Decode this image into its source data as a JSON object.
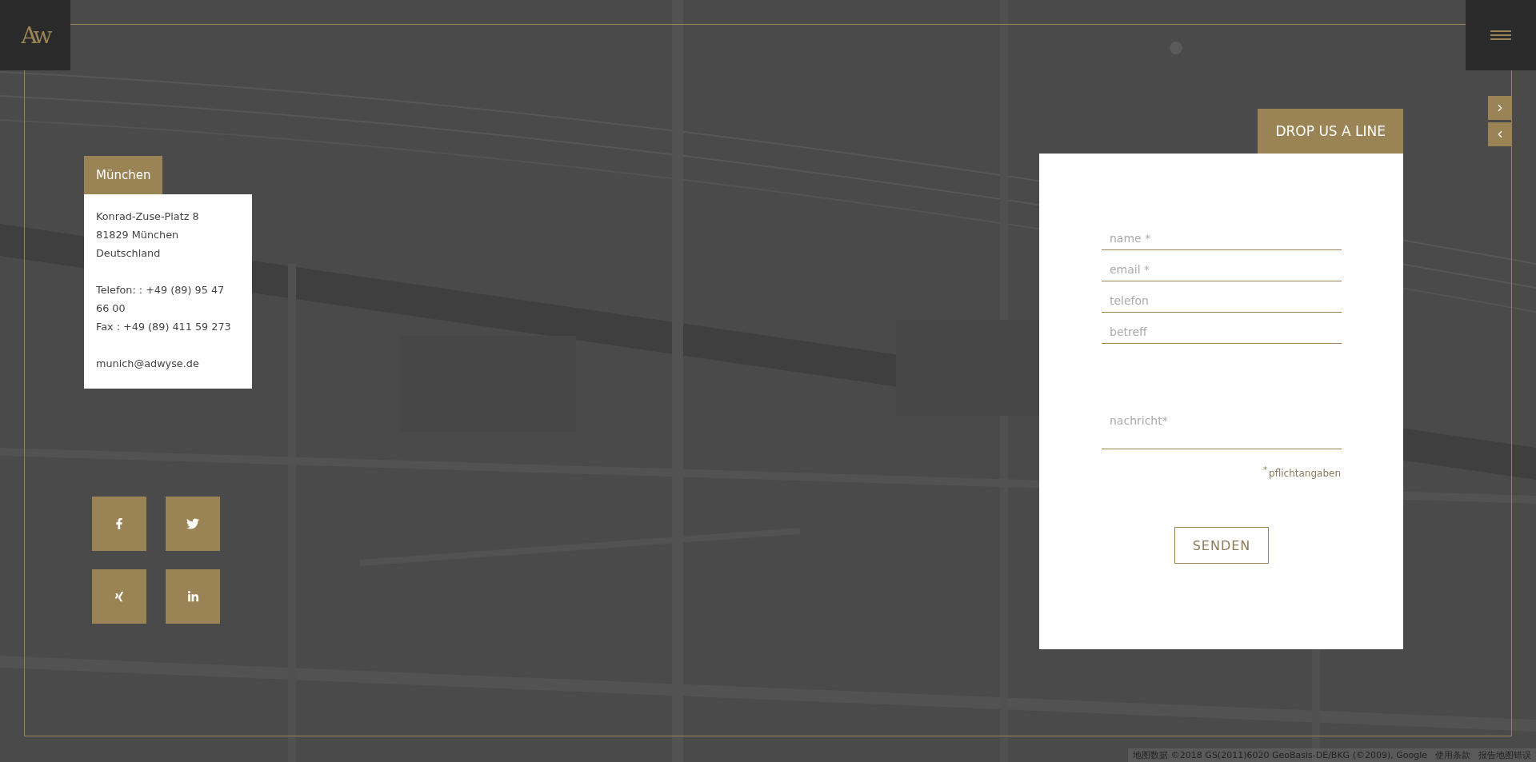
{
  "logo": {
    "text": "Aw"
  },
  "location": {
    "tab": "München",
    "address": [
      "Konrad-Zuse-Platz 8",
      "81829 München",
      "Deutschland"
    ],
    "phone": "Telefon: : +49 (89) 95 47 66 00",
    "fax": "Fax : +49 (89) 411 59 273",
    "email": "munich@adwyse.de"
  },
  "social": [
    {
      "kind": "facebook"
    },
    {
      "kind": "twitter"
    },
    {
      "kind": "xing"
    },
    {
      "kind": "linkedin"
    }
  ],
  "form": {
    "title": "DROP US A LINE",
    "fields": [
      {
        "kind": "input",
        "placeholder": "name *"
      },
      {
        "kind": "input",
        "placeholder": "email *"
      },
      {
        "kind": "input",
        "placeholder": "telefon"
      },
      {
        "kind": "input",
        "placeholder": "betreff"
      },
      {
        "kind": "textarea",
        "placeholder": "nachricht*"
      }
    ],
    "note_mark": "*",
    "note": "pflichtangaben",
    "submit": "SENDEN"
  },
  "map_attribution": {
    "data": "地图数据 ©2018 GS(2011)6020 GeoBasis-DE/BKG (©2009), Google",
    "terms": "使用条款",
    "report": "报告地图错误"
  }
}
